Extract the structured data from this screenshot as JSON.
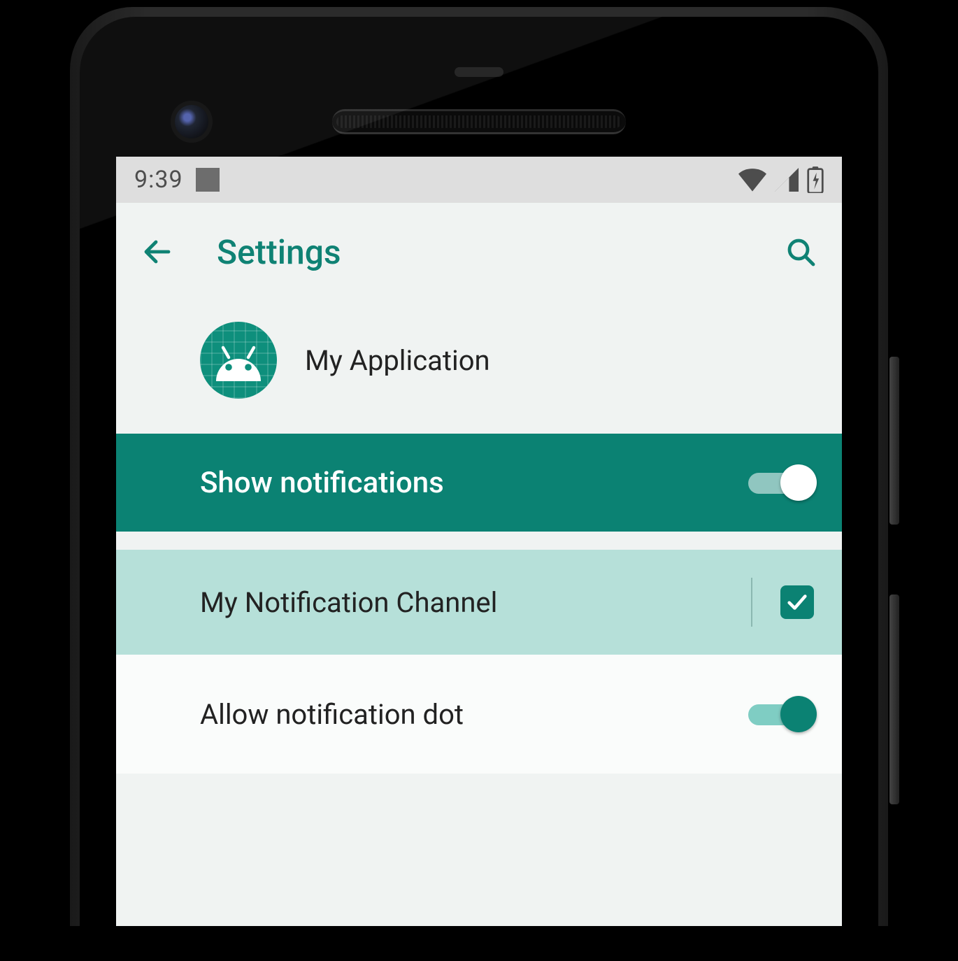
{
  "colors": {
    "accent": "#0f8274",
    "banner": "#0b8273",
    "channelBg": "#b6e0d9"
  },
  "statusBar": {
    "time": "9:39"
  },
  "appBar": {
    "title": "Settings"
  },
  "appHeader": {
    "name": "My Application"
  },
  "banner": {
    "label": "Show notifications",
    "switchOn": true
  },
  "channel": {
    "label": "My Notification Channel",
    "checked": true
  },
  "dotRow": {
    "label": "Allow notification dot",
    "switchOn": true
  }
}
